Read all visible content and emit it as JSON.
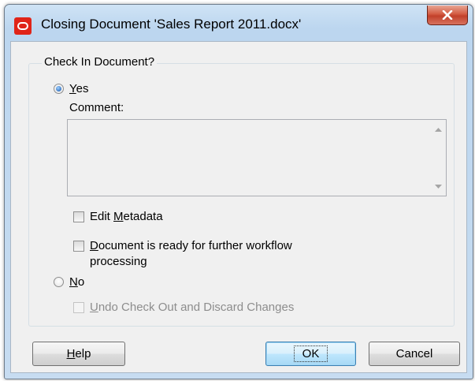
{
  "window": {
    "title": "Closing Document 'Sales Report 2011.docx'",
    "close_icon": "close-x-icon",
    "app_icon": "oracle-logo-icon",
    "accent_color": "#e02418"
  },
  "group": {
    "label": "Check In Document?"
  },
  "options": {
    "yes": {
      "label_hotkey": "Y",
      "label_rest": "es",
      "selected": true
    },
    "comment": {
      "label": "Comment:",
      "value": ""
    },
    "edit_metadata": {
      "label_pre": "Edit ",
      "label_hotkey": "M",
      "label_rest": "etadata",
      "checked": false
    },
    "workflow": {
      "label_hotkey": "D",
      "label_line1_rest": "ocument is ready for further workflow",
      "label_line2": "processing",
      "checked": false
    },
    "no": {
      "label_hotkey": "N",
      "label_rest": "o",
      "selected": false
    },
    "undo": {
      "label_hotkey": "U",
      "label_rest": "ndo Check Out and Discard Changes",
      "checked": false,
      "disabled": true
    }
  },
  "buttons": {
    "help": {
      "hotkey": "H",
      "rest": "elp"
    },
    "ok": "OK",
    "cancel": "Cancel"
  }
}
